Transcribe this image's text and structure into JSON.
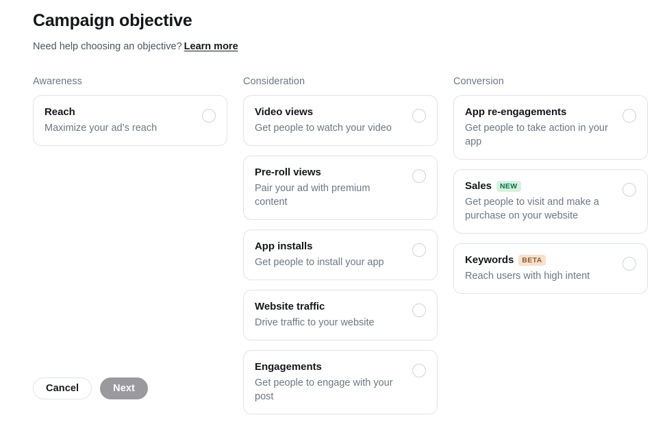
{
  "header": {
    "title": "Campaign objective",
    "help_text": "Need help choosing an objective?",
    "learn_more_label": "Learn more"
  },
  "columns": [
    {
      "name": "awareness",
      "header": "Awareness",
      "cards": [
        {
          "title": "Reach",
          "description": "Maximize your ad’s reach",
          "badge": null,
          "selected": false
        }
      ]
    },
    {
      "name": "consideration",
      "header": "Consideration",
      "cards": [
        {
          "title": "Video views",
          "description": "Get people to watch your video",
          "badge": null,
          "selected": false
        },
        {
          "title": "Pre-roll views",
          "description": "Pair your ad with premium content",
          "badge": null,
          "selected": false
        },
        {
          "title": "App installs",
          "description": "Get people to install your app",
          "badge": null,
          "selected": false
        },
        {
          "title": "Website traffic",
          "description": "Drive traffic to your website",
          "badge": null,
          "selected": false
        },
        {
          "title": "Engagements",
          "description": "Get people to engage with your post",
          "badge": null,
          "selected": false
        }
      ]
    },
    {
      "name": "conversion",
      "header": "Conversion",
      "cards": [
        {
          "title": "App re-engagements",
          "description": "Get people to take action in your app",
          "badge": null,
          "selected": false
        },
        {
          "title": "Sales",
          "description": "Get people to visit and make a purchase on your website",
          "badge": "NEW",
          "badge_kind": "new",
          "selected": false
        },
        {
          "title": "Keywords",
          "description": "Reach users with high intent",
          "badge": "BETA",
          "badge_kind": "beta",
          "selected": false
        }
      ]
    }
  ],
  "footer": {
    "cancel_label": "Cancel",
    "next_label": "Next"
  },
  "colors": {
    "badge_new_bg": "#d6f0dd",
    "badge_new_text": "#00704a",
    "badge_beta_bg": "#fae0cc",
    "badge_beta_text": "#8a5a3b",
    "card_border": "#dfe3e8",
    "radio_border": "#ccd3db",
    "muted_text": "#6b7785",
    "next_button_bg": "#9a9a9e"
  }
}
